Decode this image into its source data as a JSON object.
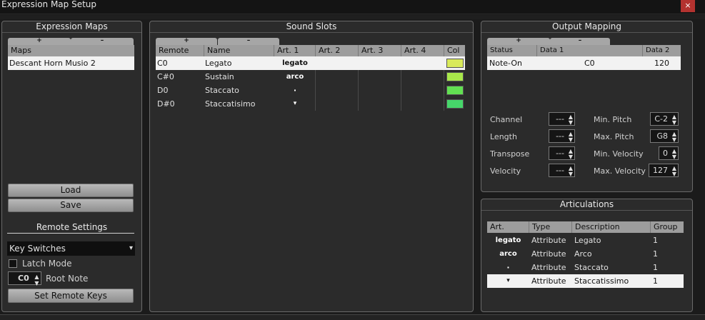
{
  "window": {
    "title": "Expression Map Setup",
    "close": "×"
  },
  "expression_maps": {
    "title": "Expression Maps",
    "plus": "+",
    "minus": "–",
    "header": "Maps",
    "items": [
      "Descant Horn Musio 2"
    ],
    "load": "Load",
    "save": "Save"
  },
  "remote_settings": {
    "title": "Remote Settings",
    "mode": "Key Switches",
    "latch_label": "Latch Mode",
    "root_value": "C0",
    "root_label": "Root Note",
    "set_keys": "Set Remote Keys"
  },
  "sound_slots": {
    "title": "Sound Slots",
    "plus": "+",
    "minus": "–",
    "headers": [
      "Remote",
      "Name",
      "Art. 1",
      "Art. 2",
      "Art. 3",
      "Art. 4",
      "Col"
    ],
    "rows": [
      {
        "remote": "C0",
        "name": "Legato",
        "art1": "legato",
        "color": "#d9ea5a"
      },
      {
        "remote": "C#0",
        "name": "Sustain",
        "art1": "arco",
        "color": "#a8e84a"
      },
      {
        "remote": "D0",
        "name": "Staccato",
        "art1": "·",
        "color": "#62e052"
      },
      {
        "remote": "D#0",
        "name": "Staccatisimo",
        "art1": "▾",
        "color": "#46d66a"
      }
    ]
  },
  "output_mapping": {
    "title": "Output Mapping",
    "plus": "+",
    "minus": "–",
    "headers": [
      "Status",
      "Data 1",
      "Data 2"
    ],
    "rows": [
      {
        "status": "Note-On",
        "data1": "C0",
        "data2": "120"
      }
    ],
    "fields": {
      "channel": {
        "label": "Channel",
        "value": "---"
      },
      "length": {
        "label": "Length",
        "value": "---"
      },
      "transpose": {
        "label": "Transpose",
        "value": "---"
      },
      "velocity": {
        "label": "Velocity",
        "value": "---"
      },
      "min_pitch": {
        "label": "Min. Pitch",
        "value": "C-2"
      },
      "max_pitch": {
        "label": "Max. Pitch",
        "value": "G8"
      },
      "min_velocity": {
        "label": "Min. Velocity",
        "value": "0"
      },
      "max_velocity": {
        "label": "Max. Velocity",
        "value": "127"
      }
    }
  },
  "articulations": {
    "title": "Articulations",
    "headers": [
      "Art.",
      "Type",
      "Description",
      "Group"
    ],
    "rows": [
      {
        "art": "legato",
        "type": "Attribute",
        "desc": "Legato",
        "group": "1"
      },
      {
        "art": "arco",
        "type": "Attribute",
        "desc": "Arco",
        "group": "1"
      },
      {
        "art": "·",
        "type": "Attribute",
        "desc": "Staccato",
        "group": "1"
      },
      {
        "art": "▾",
        "type": "Attribute",
        "desc": "Staccatissimo",
        "group": "1"
      }
    ]
  },
  "icons": {
    "spin": "▲▼",
    "dropdown": "▾"
  }
}
